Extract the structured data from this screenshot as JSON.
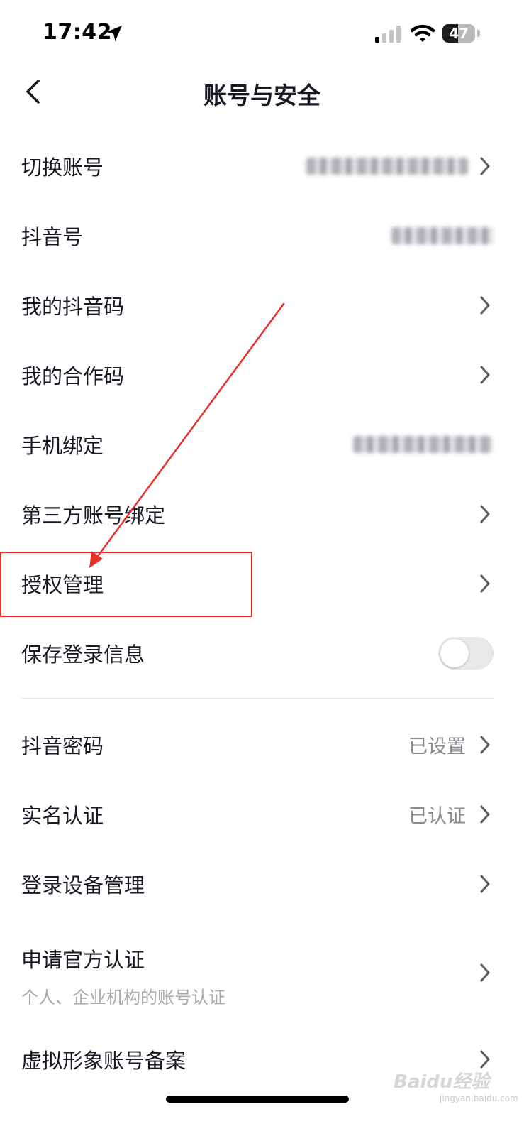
{
  "status_bar": {
    "time": "17:42",
    "battery": "47",
    "battery_level": 0.47
  },
  "nav": {
    "title": "账号与安全"
  },
  "rows": [
    {
      "label": "切换账号"
    },
    {
      "label": "抖音号"
    },
    {
      "label": "我的抖音码"
    },
    {
      "label": "我的合作码"
    },
    {
      "label": "手机绑定"
    },
    {
      "label": "第三方账号绑定"
    },
    {
      "label": "授权管理"
    },
    {
      "label": "保存登录信息",
      "toggle_on": false
    },
    {
      "label": "抖音密码",
      "value": "已设置"
    },
    {
      "label": "实名认证",
      "value": "已认证"
    },
    {
      "label": "登录设备管理"
    },
    {
      "label": "申请官方认证",
      "sublabel": "个人、企业机构的账号认证"
    },
    {
      "label": "虚拟形象账号备案"
    }
  ],
  "watermark": {
    "brand": "Baidu经验",
    "site": "jingyan.baidu.com"
  },
  "colors": {
    "annotation": "#e8302b",
    "text": "#161823",
    "secondary": "#8a8b91"
  }
}
